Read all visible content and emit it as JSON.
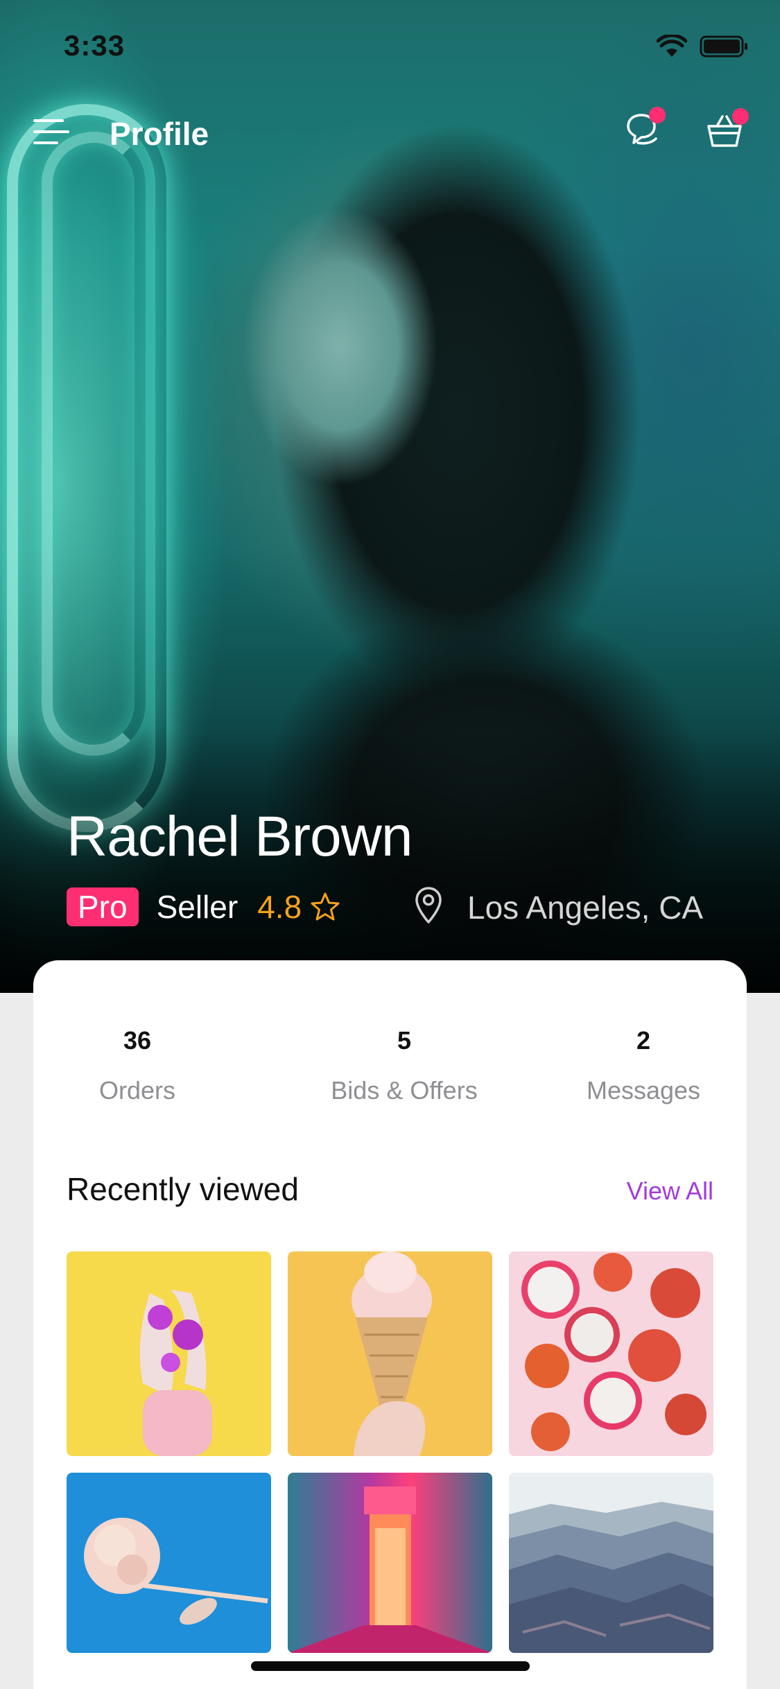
{
  "status_bar": {
    "time": "3:33"
  },
  "nav": {
    "title": "Profile",
    "chat_badge": true,
    "cart_badge": true
  },
  "profile": {
    "name": "Rachel Brown",
    "badge": "Pro",
    "role": "Seller",
    "rating": "4.8",
    "location": "Los Angeles, CA"
  },
  "stats": [
    {
      "value": "36",
      "label": "Orders"
    },
    {
      "value": "5",
      "label": "Bids & Offers"
    },
    {
      "value": "2",
      "label": "Messages"
    }
  ],
  "recent": {
    "title": "Recently viewed",
    "view_all": "View All",
    "items": [
      "painted-hands",
      "ice-cream-cone",
      "sliced-fruits",
      "paper-rose",
      "neon-corridor",
      "mountain-landscape"
    ]
  },
  "colors": {
    "accent_pink": "#ff2e73",
    "rating_orange": "#f7a21b",
    "link_purple": "#a23bdc"
  }
}
